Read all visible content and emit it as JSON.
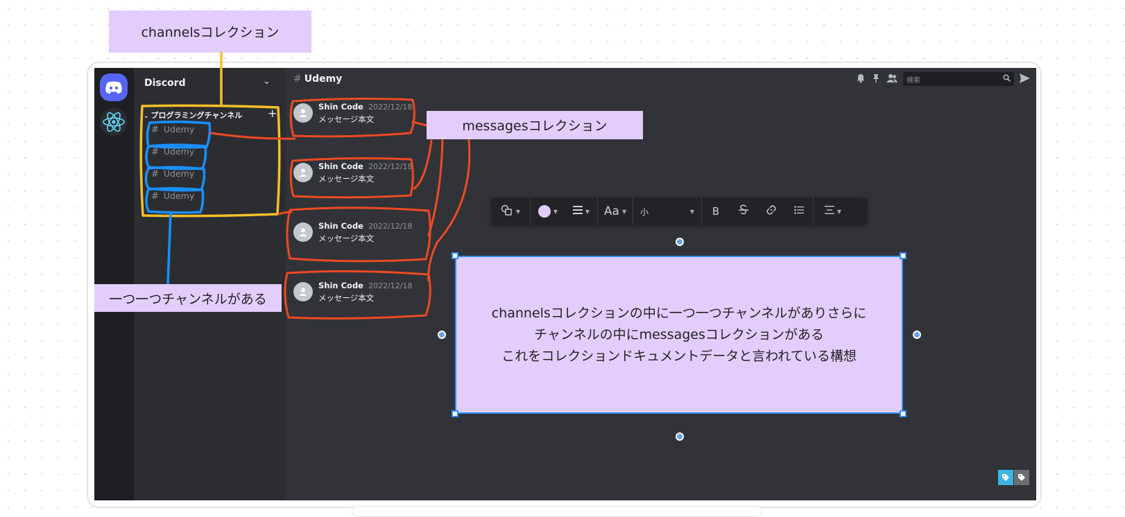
{
  "labels": {
    "channels_collection": "channelsコレクション",
    "messages_collection": "messagesコレクション",
    "one_channel_each": "一つ一つチャンネルがある"
  },
  "description_box": {
    "line1": "channelsコレクションの中に一つ一つチャンネルがありさらに",
    "line2": "チャンネルの中にmessagesコレクションがある",
    "line3": "これをコレクションドキュメントデータと言われている構想"
  },
  "discord": {
    "server_name": "Discord",
    "category": "プログラミングチャンネル",
    "channels": [
      "Udemy",
      "Udemy",
      "Udemy",
      "Udemy"
    ],
    "current_channel": "Udemy",
    "search_placeholder": "検索",
    "messages": [
      {
        "author": "Shin Code",
        "date": "2022/12/18",
        "body": "メッセージ本文"
      },
      {
        "author": "Shin Code",
        "date": "2022/12/18",
        "body": "メッセージ本文"
      },
      {
        "author": "Shin Code",
        "date": "2022/12/18",
        "body": "メッセージ本文"
      },
      {
        "author": "Shin Code",
        "date": "2022/12/18",
        "body": "メッセージ本文"
      }
    ]
  },
  "toolbar": {
    "font_label": "Aa",
    "size_value": "小",
    "bold": "B",
    "fill_color": "#e3cdfd"
  },
  "colors": {
    "annotation_fill": "#e3cdfd",
    "channels_outline": "#f6c02a",
    "channel_item_outline": "#1a8fff",
    "message_outline": "#ee4a22",
    "selection": "#2e90ff"
  }
}
